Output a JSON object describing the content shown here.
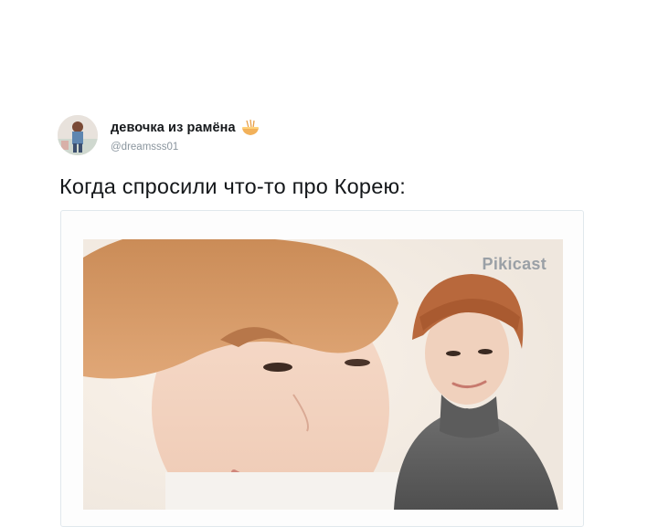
{
  "tweet": {
    "author": {
      "display_name": "девочка из рамёна",
      "handle": "@dreamsss01",
      "name_emoji": "ramen-bowl-icon"
    },
    "text": "Когда спросили что-то про Корею:",
    "media": {
      "watermark": "Pikicast"
    }
  },
  "colors": {
    "text": "#14171a",
    "handle": "#8a959e",
    "card_border": "#e1e8ed",
    "watermark": "#9aa0a6"
  }
}
